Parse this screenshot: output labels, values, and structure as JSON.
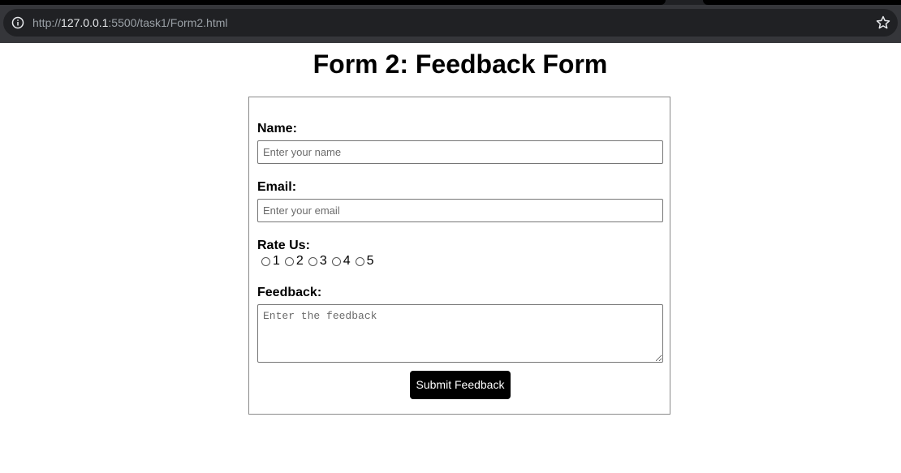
{
  "browser": {
    "url_scheme": "http://",
    "url_host": "127.0.0.1",
    "url_rest": ":5500/task1/Form2.html",
    "icons": [
      "info-icon",
      "star-icon"
    ]
  },
  "page": {
    "title": "Form 2: Feedback Form"
  },
  "form": {
    "name_label": "Name:",
    "name_placeholder": "Enter your name",
    "email_label": "Email:",
    "email_placeholder": "Enter your email",
    "rate_label": "Rate Us:",
    "ratings": [
      "1",
      "2",
      "3",
      "4",
      "5"
    ],
    "feedback_label": "Feedback:",
    "feedback_placeholder": "Enter the feedback",
    "submit_label": "Submit Feedback"
  },
  "colors": {
    "chrome_toolbar": "#35363a",
    "omnibox": "#202124",
    "button_bg": "#000000",
    "button_text": "#ffffff",
    "form_border": "#8a8a8a"
  }
}
